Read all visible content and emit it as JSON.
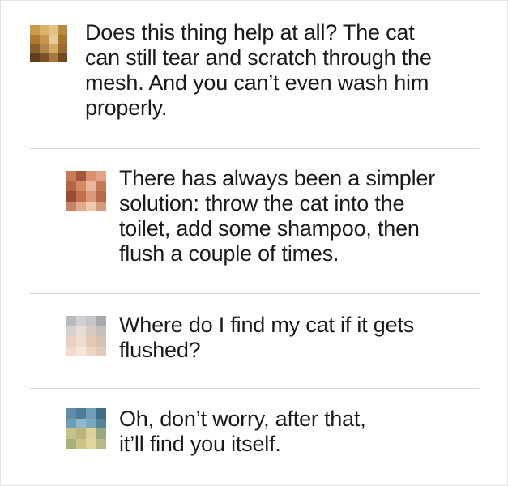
{
  "thread": {
    "comments": [
      {
        "text": "Does this thing help at all? The cat\ncan still tear and scratch through the\nmesh. And you can’t even wash him\nproperly.",
        "avatar_icon": "pixelated-avatar-icon",
        "avatar_colors": [
          "#c89a4a",
          "#d9b26a",
          "#e2c184",
          "#b98a3c",
          "#b07a2e",
          "#c69550",
          "#e6c995",
          "#a8772c",
          "#8a5f2a",
          "#b38447",
          "#d2a865",
          "#9a6a30",
          "#5e3f1d",
          "#7a5427",
          "#a67a3f",
          "#6b4a24"
        ]
      },
      {
        "text": "There has always been a simpler\nsolution: throw the cat into the\ntoilet, add some shampoo, then\nflush a couple of times.",
        "avatar_icon": "pixelated-avatar-icon",
        "avatar_colors": [
          "#c77a55",
          "#a4563a",
          "#d99070",
          "#e2a488",
          "#b5653f",
          "#d58a62",
          "#e8b69b",
          "#c47a55",
          "#9a4c30",
          "#c1704b",
          "#d99a78",
          "#b86a48",
          "#c88566",
          "#e0a98c",
          "#f0c8b0",
          "#d39a7c"
        ]
      },
      {
        "text": "Where do I find my cat if it gets\nflushed?",
        "avatar_icon": "pixelated-avatar-icon",
        "avatar_colors": [
          "#b9b9c0",
          "#d0cfd4",
          "#c4c4ca",
          "#a9a8b0",
          "#d8d0cc",
          "#e8ddd6",
          "#d9c9c1",
          "#c7bdb9",
          "#e9d2c4",
          "#f1dccf",
          "#e5c8b6",
          "#d8c1b3",
          "#f0dbcd",
          "#f6e6dc",
          "#eed6c6",
          "#e2cbbd"
        ]
      },
      {
        "text": "Oh, don’t worry, after that,\nit’ll find you itself.",
        "avatar_icon": "pixelated-avatar-icon",
        "avatar_colors": [
          "#5f8fa8",
          "#4d7d99",
          "#6fa0b8",
          "#3f6d86",
          "#6f9fb8",
          "#8fb8c8",
          "#7aa8bf",
          "#56849c",
          "#c6c28a",
          "#b8b67c",
          "#d9d198",
          "#9aa882",
          "#a8b07a",
          "#c9c487",
          "#e0d59e",
          "#b8b888"
        ]
      }
    ]
  }
}
